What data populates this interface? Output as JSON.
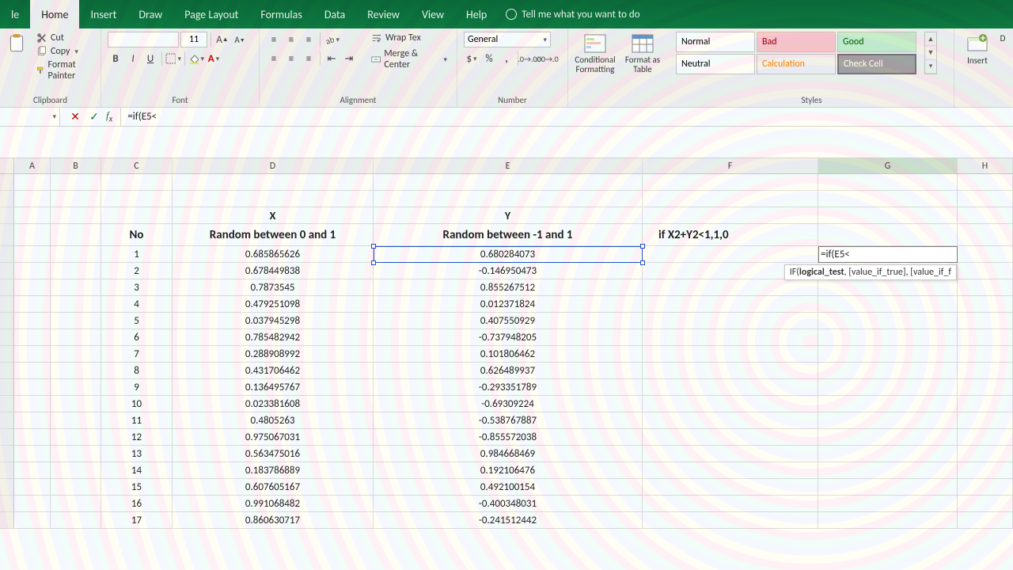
{
  "tabs": {
    "file": "le",
    "home": "Home",
    "insert": "Insert",
    "draw": "Draw",
    "pagelayout": "Page Layout",
    "formulas": "Formulas",
    "data": "Data",
    "review": "Review",
    "view": "View",
    "help": "Help",
    "tellme": "Tell me what you want to do"
  },
  "clipboard": {
    "cut": "Cut",
    "copy": "Copy",
    "fmtpainter": "Format Painter",
    "label": "Clipboard"
  },
  "font": {
    "name": "",
    "size": "11",
    "label": "Font"
  },
  "alignment": {
    "wrap": "Wrap Tex",
    "merge": "Merge & Center",
    "label": "Alignment"
  },
  "number": {
    "format": "General",
    "label": "Number"
  },
  "condfmt": {
    "cf": "Conditional\nFormatting",
    "fat": "Format as\nTable"
  },
  "styles": {
    "normal": "Normal",
    "bad": "Bad",
    "good": "Good",
    "neutral": "Neutral",
    "calc": "Calculation",
    "check": "Check Cell",
    "label": "Styles"
  },
  "cells": {
    "insert": "Insert",
    "delete": "D"
  },
  "namebox": "",
  "formula": "=if(E5<",
  "columns": [
    "A",
    "B",
    "C",
    "D",
    "E",
    "F",
    "G",
    "H"
  ],
  "headers": {
    "D_top": "X",
    "E_top": "Y",
    "C": "No",
    "D": "Random between 0 and 1",
    "E": "Random between -1 and 1",
    "F": "if  X2+Y2<1,1,0"
  },
  "editing_cell": "=if(E5<",
  "fn_tooltip": "IF(logical_test, [value_if_true], [value_if_f",
  "rows": [
    {
      "n": "1",
      "x": "0.685865626",
      "y": "0.680284073"
    },
    {
      "n": "2",
      "x": "0.678449838",
      "y": "-0.146950473"
    },
    {
      "n": "3",
      "x": "0.7873545",
      "y": "0.855267512"
    },
    {
      "n": "4",
      "x": "0.479251098",
      "y": "0.012371824"
    },
    {
      "n": "5",
      "x": "0.037945298",
      "y": "0.407550929"
    },
    {
      "n": "6",
      "x": "0.785482942",
      "y": "-0.737948205"
    },
    {
      "n": "7",
      "x": "0.288908992",
      "y": "0.101806462"
    },
    {
      "n": "8",
      "x": "0.431706462",
      "y": "0.626489937"
    },
    {
      "n": "9",
      "x": "0.136495767",
      "y": "-0.293351789"
    },
    {
      "n": "10",
      "x": "0.023381608",
      "y": "-0.69309224"
    },
    {
      "n": "11",
      "x": "0.4805263",
      "y": "-0.538767887"
    },
    {
      "n": "12",
      "x": "0.975067031",
      "y": "-0.855572038"
    },
    {
      "n": "13",
      "x": "0.563475016",
      "y": "0.984668469"
    },
    {
      "n": "14",
      "x": "0.183786889",
      "y": "0.192106476"
    },
    {
      "n": "15",
      "x": "0.607605167",
      "y": "0.492100154"
    },
    {
      "n": "16",
      "x": "0.991068482",
      "y": "-0.400348031"
    },
    {
      "n": "17",
      "x": "0.860630717",
      "y": "-0.241512442"
    }
  ]
}
